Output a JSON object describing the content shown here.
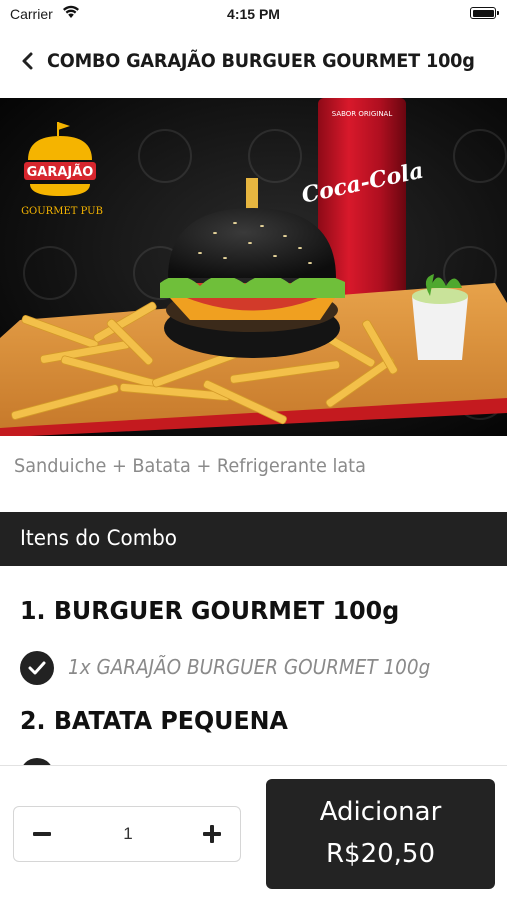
{
  "status_bar": {
    "carrier": "Carrier",
    "time": "4:15 PM"
  },
  "header": {
    "title": "COMBO GARAJÃO BURGUER GOURMET 100g",
    "back_icon": "chevron-left-icon"
  },
  "hero": {
    "logo_name": "GARAJÃO",
    "logo_subtitle": "GOURMET PUB",
    "can_text": "Coca-Cola",
    "can_top_text": "SABOR ORIGINAL"
  },
  "description": "Sanduiche + Batata + Refrigerante lata",
  "section": {
    "title": "Itens do Combo"
  },
  "items": [
    {
      "heading": "1. BURGUER GOURMET 100g",
      "option": "1x GARAJÃO BURGUER GOURMET 100g"
    },
    {
      "heading": "2. BATATA PEQUENA"
    }
  ],
  "footer": {
    "quantity": "1",
    "add_label": "Adicionar",
    "add_price": "R$20,50"
  },
  "colors": {
    "dark": "#222222",
    "muted_text": "#8a8a8a",
    "coke_red": "#c8102e",
    "logo_yellow": "#f5b400"
  }
}
